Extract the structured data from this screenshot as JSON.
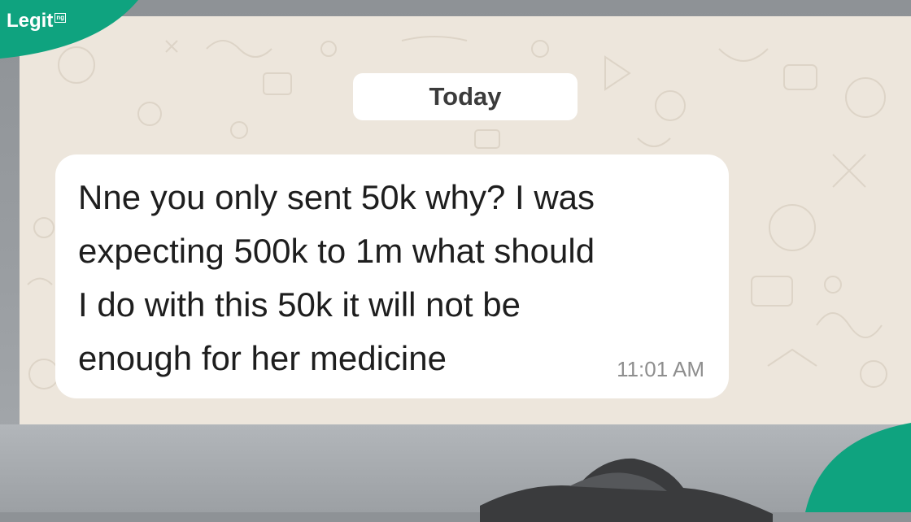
{
  "brand": {
    "logo_text": "Legit",
    "logo_badge": "ng",
    "accent_color": "#0fa37f"
  },
  "chat": {
    "wallpaper_color": "#ede6dc",
    "date_separator": "Today",
    "message": {
      "lines": [
        "Nne you only sent 50k why? I was",
        "expecting 500k to 1m what should",
        "I do with this 50k it will not be",
        "enough for her medicine"
      ],
      "time": "11:01 AM",
      "bubble_color": "#ffffff"
    }
  }
}
